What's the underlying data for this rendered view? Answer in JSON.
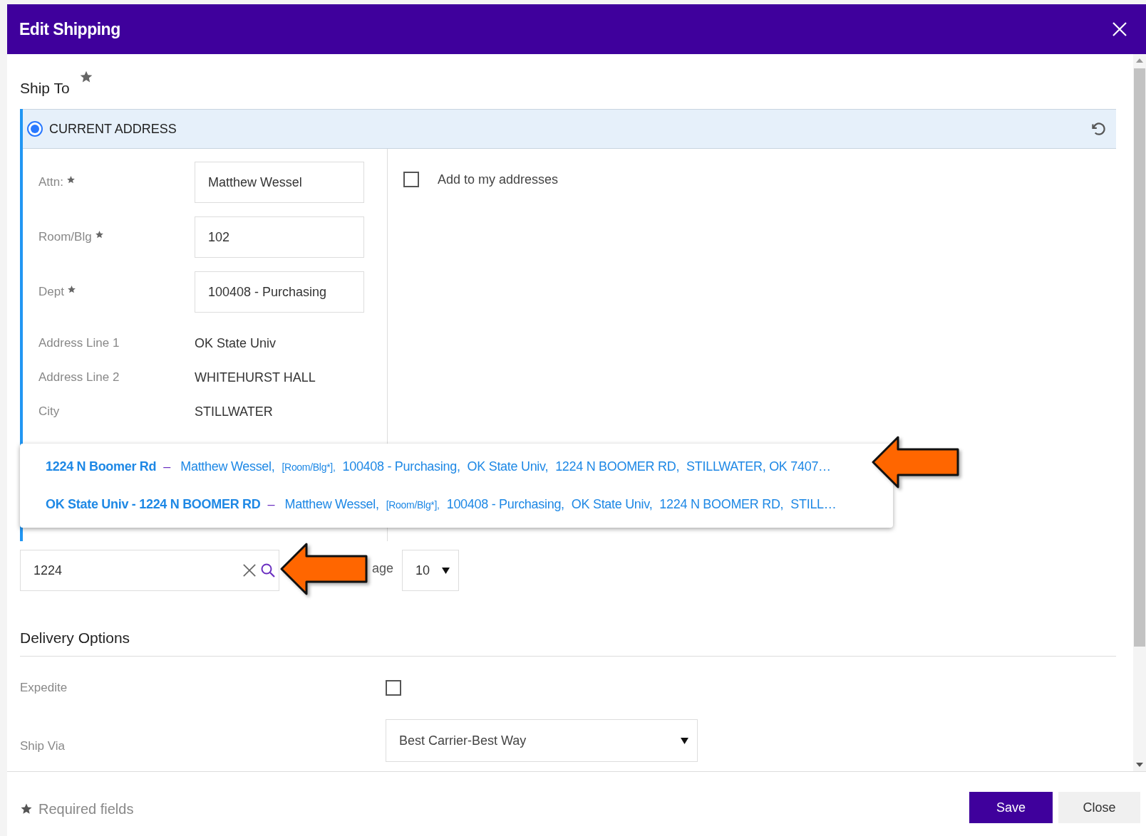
{
  "window": {
    "title": "Edit Shipping"
  },
  "ship_to": {
    "title": "Ship To",
    "current_address": {
      "label": "CURRENT ADDRESS",
      "selected": true
    },
    "fields": [
      {
        "kind": "input",
        "label": "Attn:",
        "required": true,
        "value": "Matthew Wessel"
      },
      {
        "kind": "input",
        "label": "Room/Blg",
        "required": true,
        "value": "102"
      },
      {
        "kind": "input",
        "label": "Dept",
        "required": true,
        "value": "100408 - Purchasing"
      },
      {
        "kind": "text",
        "label": "Address Line 1",
        "required": false,
        "value": "OK State Univ"
      },
      {
        "kind": "text",
        "label": "Address Line 2",
        "required": false,
        "value": "WHITEHURST HALL"
      },
      {
        "kind": "text",
        "label": "City",
        "required": false,
        "value": "STILLWATER"
      }
    ],
    "add_to_addresses": {
      "label": "Add to my addresses",
      "checked": false
    }
  },
  "suggestions": [
    {
      "title": "1224 N Boomer Rd",
      "separator": "–",
      "parts": [
        {
          "kind": "text",
          "text": "Matthew Wessel,"
        },
        {
          "kind": "small",
          "text": "[Room/Blg*],"
        },
        {
          "kind": "text",
          "text": "100408 - Purchasing,"
        },
        {
          "kind": "text",
          "text": "OK State Univ,"
        },
        {
          "kind": "text",
          "text": "1224 N BOOMER RD,"
        },
        {
          "kind": "text",
          "text": "STILLWATER, OK 7407…"
        }
      ]
    },
    {
      "title": "OK State Univ - 1224 N BOOMER RD",
      "separator": "–",
      "parts": [
        {
          "kind": "text",
          "text": "Matthew Wessel,"
        },
        {
          "kind": "small",
          "text": "[Room/Blg*],"
        },
        {
          "kind": "text",
          "text": "100408 - Purchasing,"
        },
        {
          "kind": "text",
          "text": "OK State Univ,"
        },
        {
          "kind": "text",
          "text": "1224 N BOOMER RD,"
        },
        {
          "kind": "text",
          "text": "STILL…"
        }
      ]
    }
  ],
  "search": {
    "value": "1224"
  },
  "page_size": {
    "label": "age",
    "value": "10"
  },
  "delivery_options": {
    "title": "Delivery Options",
    "expedite": {
      "label": "Expedite",
      "checked": false
    },
    "ship_via": {
      "label": "Ship Via",
      "value": "Best Carrier-Best Way"
    }
  },
  "footer": {
    "required_note": "Required fields",
    "buttons": [
      {
        "kind": "primary",
        "label": "Save"
      },
      {
        "kind": "secondary",
        "label": "Close"
      }
    ]
  }
}
